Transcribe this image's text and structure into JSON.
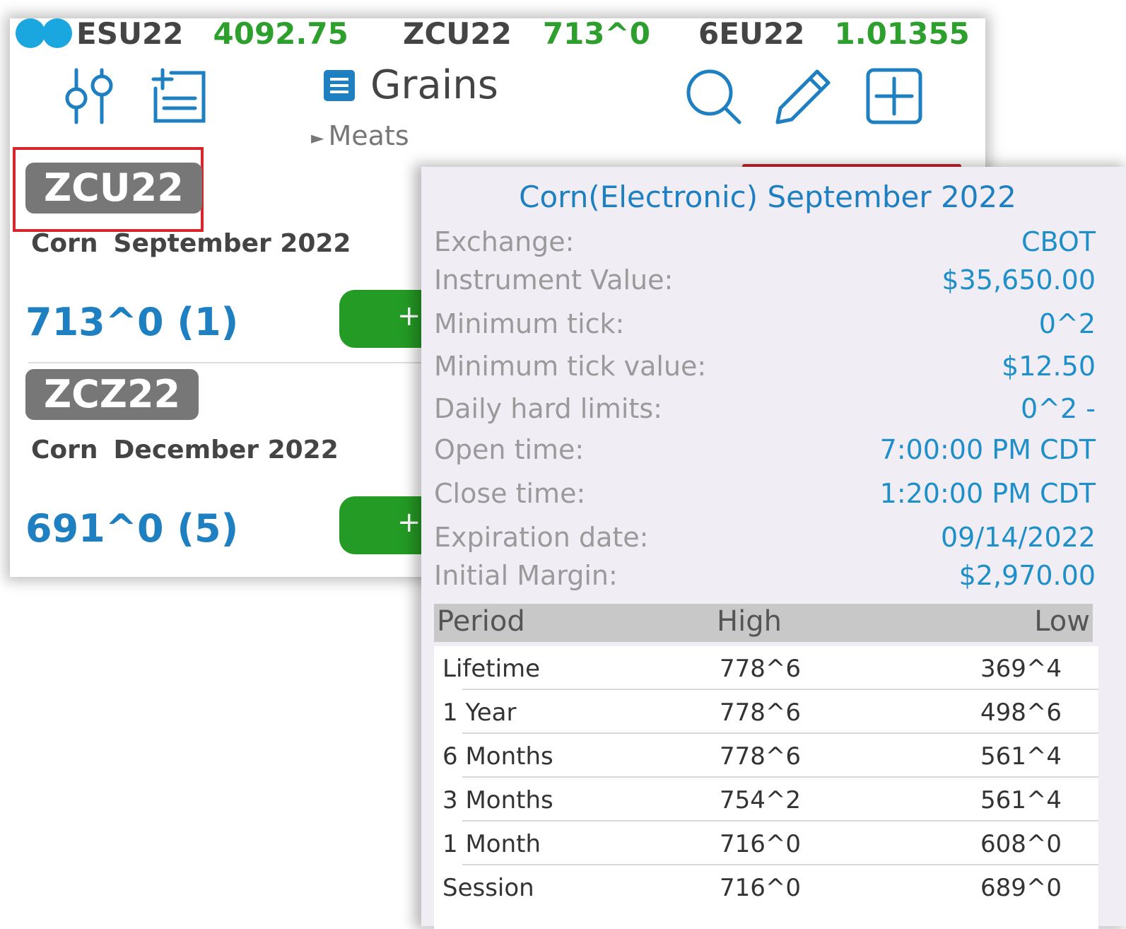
{
  "ticker": [
    {
      "symbol": "ESU22",
      "value": "4092.75"
    },
    {
      "symbol": "ZCU22",
      "value": "713^0"
    },
    {
      "symbol": "6EU22",
      "value": "1.01355"
    }
  ],
  "toolbar": {
    "filter_icon": "sliders-icon",
    "add_list_icon": "add-list-icon",
    "search_icon": "search-icon",
    "edit_icon": "pencil-icon",
    "add_icon": "plus-square-icon"
  },
  "group": {
    "title": "Grains",
    "next": "Meats"
  },
  "watchlist": [
    {
      "symbol": "ZCU22",
      "name": "Corn",
      "month": "September 2022",
      "price": "713^0 (1)",
      "button": "+"
    },
    {
      "symbol": "ZCZ22",
      "name": "Corn",
      "month": "December 2022",
      "price": "691^0 (5)",
      "button": "+"
    }
  ],
  "detail": {
    "title": "Corn(Electronic) September 2022",
    "rows": [
      {
        "label": "Exchange:",
        "value": "CBOT"
      },
      {
        "label": "Instrument Value:",
        "value": "$35,650.00"
      },
      {
        "label": "Minimum tick:",
        "value": "0^2"
      },
      {
        "label": "Minimum tick value:",
        "value": "$12.50"
      },
      {
        "label": "Daily hard limits:",
        "value": "0^2 -"
      },
      {
        "label": "Open time:",
        "value": "7:00:00 PM CDT"
      },
      {
        "label": "Close time:",
        "value": "1:20:00 PM CDT"
      },
      {
        "label": "Expiration date:",
        "value": "09/14/2022"
      },
      {
        "label": "Initial Margin:",
        "value": "$2,970.00"
      }
    ],
    "history_header": {
      "period": "Period",
      "high": "High",
      "low": "Low"
    },
    "history": [
      {
        "period": "Lifetime",
        "high": "778^6",
        "low": "369^4"
      },
      {
        "period": "1 Year",
        "high": "778^6",
        "low": "498^6"
      },
      {
        "period": "6 Months",
        "high": "778^6",
        "low": "561^4"
      },
      {
        "period": "3 Months",
        "high": "754^2",
        "low": "561^4"
      },
      {
        "period": "1 Month",
        "high": "716^0",
        "low": "608^0"
      },
      {
        "period": "Session",
        "high": "716^0",
        "low": "689^0"
      }
    ]
  },
  "colors": {
    "accent": "#1e7fc1",
    "positive": "#2d9f2d",
    "highlight": "#d9262c"
  }
}
